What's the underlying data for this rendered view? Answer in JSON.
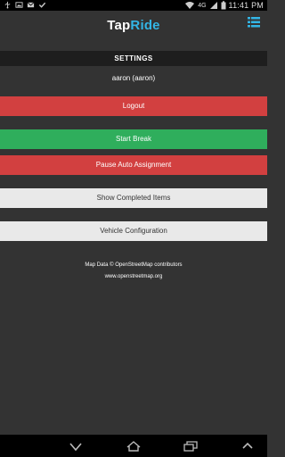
{
  "status_bar": {
    "left_icons": [
      "usb-icon",
      "image-icon",
      "gmail-icon",
      "check-icon"
    ],
    "right_icons": [
      "wifi-icon",
      "signal-icon",
      "battery-icon"
    ],
    "network_label": "4G",
    "time": "11:41 PM"
  },
  "app": {
    "brand_part1": "Tap",
    "brand_part2": "Ride",
    "brand_accent": "#33b5e5",
    "menu_icon": "list-menu-icon"
  },
  "settings": {
    "section_title": "SETTINGS",
    "user_label": "aaron (aaron)",
    "logout_label": "Logout",
    "start_break_label": "Start Break",
    "pause_label": "Pause Auto Assignment",
    "show_completed_label": "Show Completed Items",
    "vehicle_config_label": "Vehicle Configuration"
  },
  "credits": {
    "map_data": "Map Data © OpenStreetMap contributors",
    "url": "www.openstreetmap.org"
  },
  "colors": {
    "red": "#d24040",
    "green": "#2fae5c",
    "light": "#e9e9e9",
    "background": "#333333"
  },
  "nav_bar": {
    "icons": [
      "hide-keyboard-icon",
      "home-icon",
      "recent-apps-icon",
      "up-arrow-icon"
    ]
  }
}
